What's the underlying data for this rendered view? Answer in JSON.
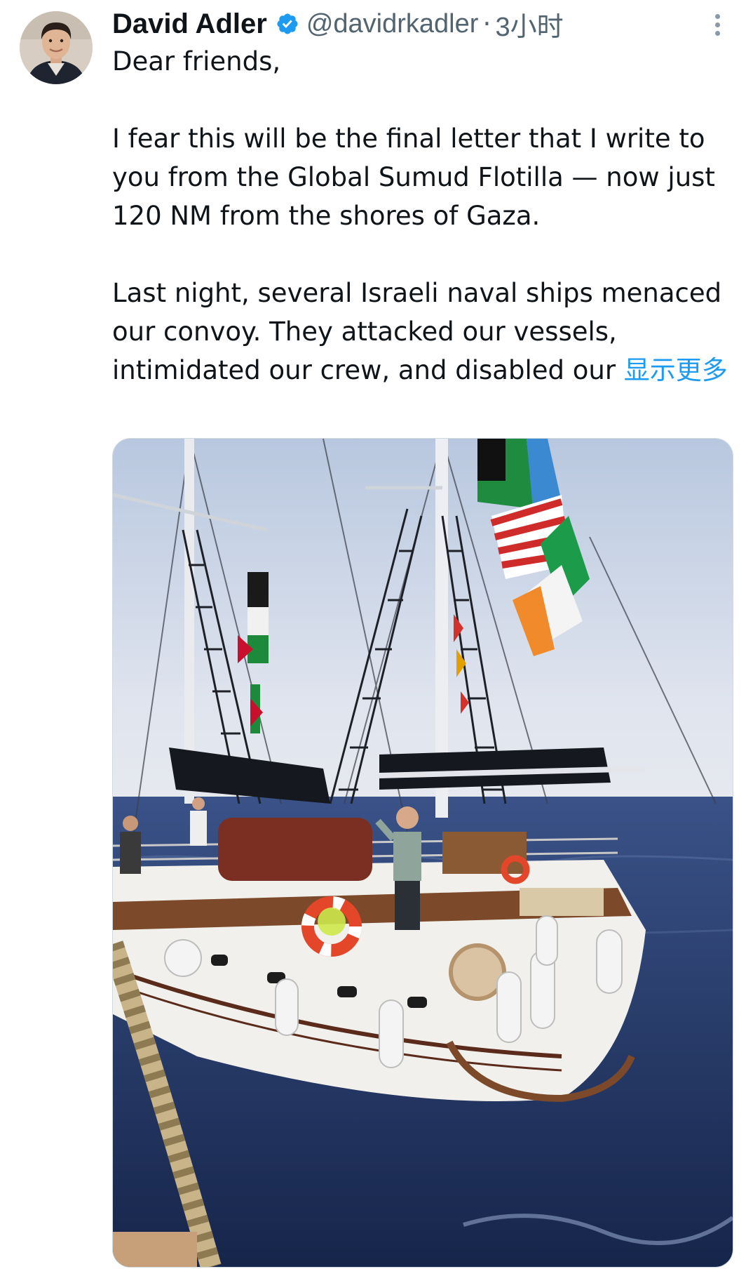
{
  "tweet": {
    "author_name": "David Adler",
    "handle": "@davidrkadler",
    "separator": "·",
    "time_ago": "3小时",
    "paragraphs": [
      "Dear friends,",
      "I fear this will be the final letter that I write to you from the Global Sumud Flotilla — now just 120 NM from the shores of Gaza.",
      "Last night, several Israeli naval ships menaced our convoy. They attacked our vessels, intimidated our crew, and disabled our"
    ],
    "show_more_label": "显示更多"
  },
  "icons": {
    "verified": "verified-badge-icon",
    "more": "more-options-icon"
  },
  "colors": {
    "text_primary": "#0f1419",
    "text_secondary": "#536471",
    "link": "#1d9bf0",
    "verified": "#1d9bf0",
    "sky": "#c9d4e4",
    "sea": "#22376a"
  }
}
